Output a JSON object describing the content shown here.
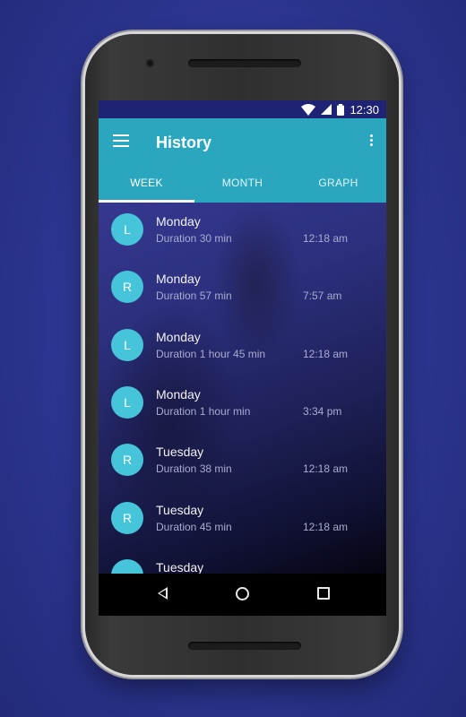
{
  "status_bar": {
    "time": "12:30",
    "icons": [
      "wifi-icon",
      "cellular-signal-icon",
      "battery-icon"
    ]
  },
  "app_bar": {
    "title": "History",
    "menu_icon": "hamburger-menu-icon",
    "overflow_icon": "more-vert-icon"
  },
  "tabs": [
    {
      "label": "WEEK",
      "active": true
    },
    {
      "label": "MONTH",
      "active": false
    },
    {
      "label": "GRAPH",
      "active": false
    }
  ],
  "history": [
    {
      "initial": "L",
      "day": "Monday",
      "duration": "Duration 30 min",
      "time": "12:18 am"
    },
    {
      "initial": "R",
      "day": "Monday",
      "duration": "Duration 57 min",
      "time": "7:57 am"
    },
    {
      "initial": "L",
      "day": "Monday",
      "duration": "Duration 1 hour 45 min",
      "time": "12:18  am"
    },
    {
      "initial": "L",
      "day": "Monday",
      "duration": "Duration 1 hour  min",
      "time": "3:34 pm"
    },
    {
      "initial": "R",
      "day": "Tuesday",
      "duration": "Duration  38 min",
      "time": "12:18  am"
    },
    {
      "initial": "R",
      "day": "Tuesday",
      "duration": "Duration 45 min",
      "time": "12:18  am"
    },
    {
      "initial": "",
      "day": "Tuesday",
      "duration": "",
      "time": ""
    }
  ],
  "nav_bar": {
    "icons": [
      "back-icon",
      "home-icon",
      "recents-icon"
    ]
  },
  "colors": {
    "background": "#2c3590",
    "status_bar": "#1e2374",
    "app_bar": "#2aa7bf",
    "avatar": "#45c4da"
  }
}
